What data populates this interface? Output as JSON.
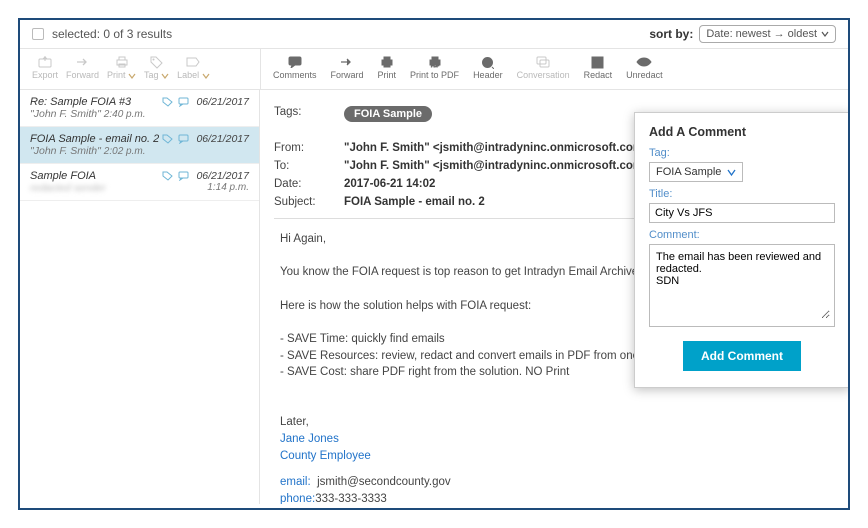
{
  "header": {
    "selected_text": "selected: 0 of 3 results",
    "sort_label": "sort by:",
    "sort_value": "Date: newest → oldest"
  },
  "left_toolbar": [
    {
      "key": "export",
      "label": "Export"
    },
    {
      "key": "forward",
      "label": "Forward"
    },
    {
      "key": "print",
      "label": "Print",
      "dropdown": true
    },
    {
      "key": "tag",
      "label": "Tag",
      "dropdown": true
    },
    {
      "key": "label",
      "label": "Label",
      "dropdown": true
    }
  ],
  "right_toolbar": [
    {
      "key": "comments",
      "label": "Comments"
    },
    {
      "key": "forward",
      "label": "Forward"
    },
    {
      "key": "print",
      "label": "Print"
    },
    {
      "key": "print-to-pdf",
      "label": "Print to PDF"
    },
    {
      "key": "header",
      "label": "Header"
    },
    {
      "key": "conversation",
      "label": "Conversation",
      "disabled": true
    },
    {
      "key": "redact",
      "label": "Redact"
    },
    {
      "key": "unredact",
      "label": "Unredact"
    }
  ],
  "list": [
    {
      "subject": "Re: Sample FOIA #3",
      "from": "\"John F. Smith\" <jsmith@intradynin…",
      "date": "06/21/2017",
      "time": "2:40 p.m.",
      "selected": false,
      "blurred": false
    },
    {
      "subject": "FOIA Sample - email no. 2",
      "from": "\"John F. Smith\" <jsmith@intradynin…",
      "date": "06/21/2017",
      "time": "2:02 p.m.",
      "selected": true,
      "blurred": false
    },
    {
      "subject": "Sample FOIA",
      "from": "redacted sender",
      "date": "06/21/2017",
      "time": "1:14 p.m.",
      "selected": false,
      "blurred": true
    }
  ],
  "message": {
    "tags_label": "Tags:",
    "tag_value": "FOIA Sample",
    "from_label": "From:",
    "from_value": "\"John F. Smith\" <jsmith@intradyninc.onmicrosoft.com>",
    "to_label": "To:",
    "to_value": "\"John F. Smith\" <jsmith@intradyninc.onmicrosoft.com>",
    "date_label": "Date:",
    "date_value": "2017-06-21 14:02",
    "subject_label": "Subject:",
    "subject_value": "FOIA Sample - email no. 2",
    "body": {
      "greeting": "Hi Again,",
      "p1": "You know the FOIA request is top reason to get Intradyn Email Archiver.",
      "p2": "Here is how the solution helps with FOIA request:",
      "b1": "- SAVE Time: quickly find emails",
      "b2": "- SAVE Resources: review, redact and convert emails in PDF from one inter",
      "b3": "- SAVE Cost: share PDF right from the solution. NO Print",
      "closing": "Later,",
      "sig_name": "Jane Jones",
      "sig_title": "County Employee",
      "email_label": "email:",
      "email_value": "jsmith@secondcounty.gov",
      "phone_label": "phone:",
      "phone_value": "333-333-3333"
    }
  },
  "comment_panel": {
    "title": "Add A Comment",
    "tag_label": "Tag:",
    "tag_value": "FOIA Sample",
    "title_label": "Title:",
    "title_value": "City Vs JFS",
    "comment_label": "Comment:",
    "comment_value": "The email has been reviewed and redacted.\nSDN ",
    "button": "Add Comment"
  }
}
